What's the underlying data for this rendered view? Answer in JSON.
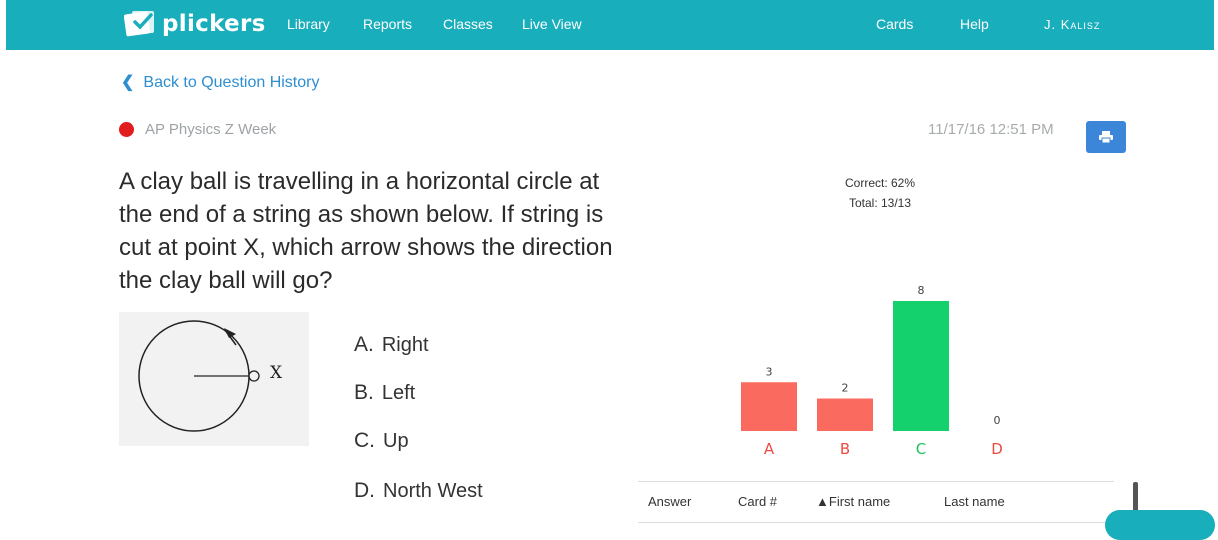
{
  "header": {
    "brand": "plickers",
    "nav": [
      "Library",
      "Reports",
      "Classes",
      "Live View"
    ],
    "right_nav": [
      "Cards",
      "Help"
    ],
    "user": "J. Kalisz",
    "bar_color": "#19aebb"
  },
  "back_link": "Back to Question History",
  "class_name": "AP Physics Z Week",
  "timestamp": "11/17/16 12:51 PM",
  "question": {
    "text": "A clay ball is travelling in a horizontal circle at the end of a string as shown below. If string is cut at point X, which arrow shows the direction the clay ball will go?",
    "figure_label": "X",
    "choices": [
      {
        "letter": "A.",
        "text": "Right"
      },
      {
        "letter": "B.",
        "text": "Left"
      },
      {
        "letter": "C.",
        "text": "Up"
      },
      {
        "letter": "D.",
        "text": "North West"
      }
    ]
  },
  "stats": {
    "correct": "Correct: 62%",
    "total": "Total: 13/13"
  },
  "chart_data": {
    "type": "bar",
    "categories": [
      "A",
      "B",
      "C",
      "D"
    ],
    "values": [
      3,
      2,
      8,
      0
    ],
    "correct": [
      false,
      false,
      true,
      false
    ],
    "colors": {
      "incorrect": "#fb6a5e",
      "correct": "#14d06d"
    },
    "label_colors": {
      "incorrect": "#ef4a42",
      "correct": "#1fbf5c"
    }
  },
  "table": {
    "columns": [
      "Answer",
      "Card #",
      "First name",
      "Last name"
    ],
    "sort_column": 2
  }
}
